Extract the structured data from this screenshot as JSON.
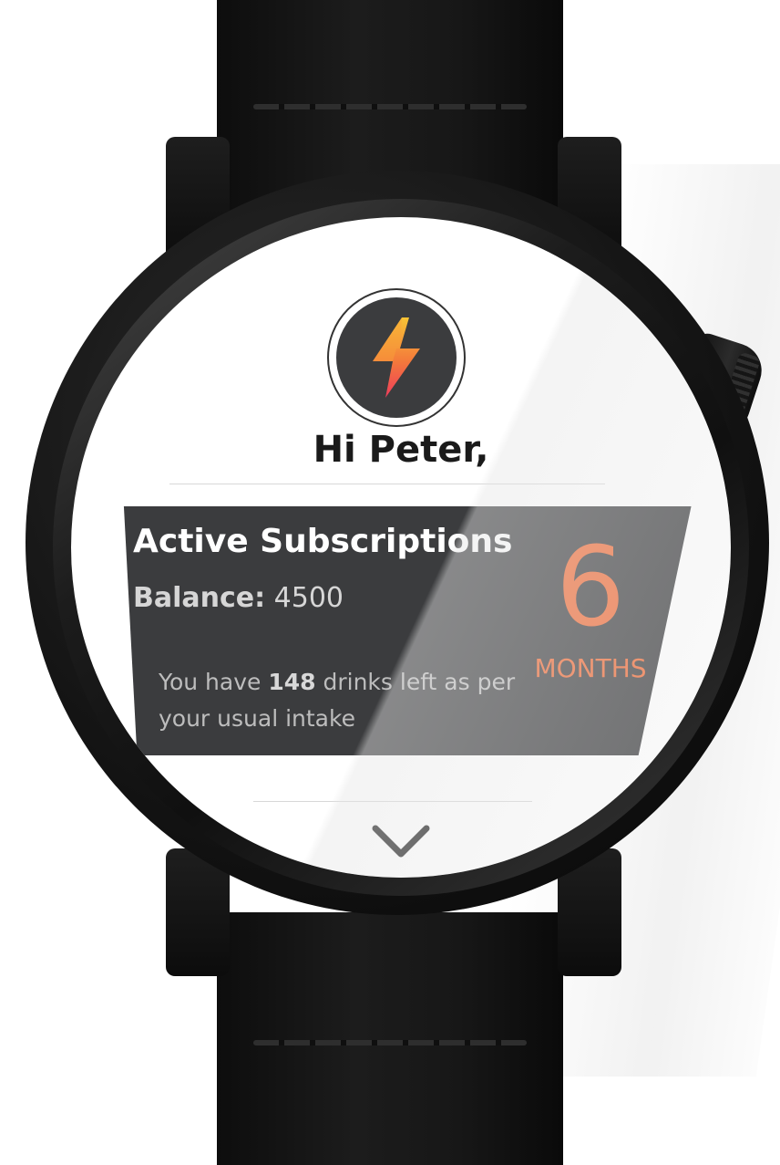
{
  "greeting": "Hi Peter,",
  "card": {
    "title": "Active Subscriptions",
    "balance_label": "Balance:",
    "balance_value": "4500",
    "drinks_prefix": "You have",
    "drinks_count": "148",
    "drinks_suffix": "drinks left as per your usual intake",
    "duration_value": "6",
    "duration_unit": "MONTHS"
  },
  "icons": {
    "logo": "lightning-bolt-icon",
    "scroll": "chevron-down-icon"
  },
  "colors": {
    "accent": "#ef6a35",
    "card_bg": "#3b3c3e",
    "bolt_top": "#f7c435",
    "bolt_bottom": "#ee3c5b"
  }
}
